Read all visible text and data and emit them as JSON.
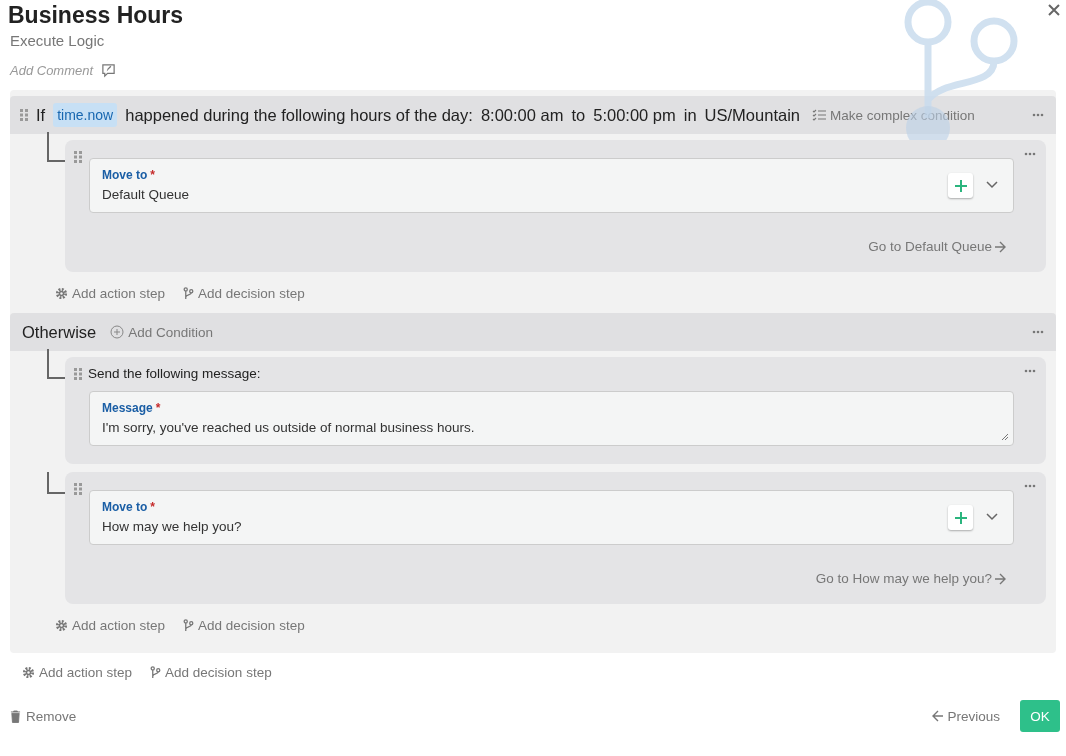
{
  "header": {
    "title": "Business Hours",
    "subtitle": "Execute Logic",
    "comment": "Add Comment"
  },
  "branches": [
    {
      "kind": "if",
      "keyword": "If",
      "variable": "time.now",
      "condition": "happened during the following hours of the day:",
      "start": "8:00:00 am",
      "to": "to",
      "end": "5:00:00 pm",
      "in": "in",
      "timezone": "US/Mountain",
      "complex": "Make complex condition",
      "steps": [
        {
          "kind": "move",
          "label": "Move to",
          "required": "*",
          "value": "Default Queue",
          "link": "Go to Default Queue"
        }
      ],
      "add_action": "Add action step",
      "add_decision": "Add decision step"
    },
    {
      "kind": "otherwise",
      "keyword": "Otherwise",
      "add_condition": "Add Condition",
      "steps": [
        {
          "kind": "message",
          "title": "Send the following message:",
          "label": "Message",
          "required": "*",
          "value": "I'm sorry, you've reached us outside of normal business hours."
        },
        {
          "kind": "move",
          "label": "Move to",
          "required": "*",
          "value": "How may we help you?",
          "link": "Go to How may we help you?"
        }
      ],
      "add_action": "Add action step",
      "add_decision": "Add decision step"
    }
  ],
  "add_action": "Add action step",
  "add_decision": "Add decision step",
  "footer": {
    "remove": "Remove",
    "previous": "Previous",
    "ok": "OK"
  }
}
